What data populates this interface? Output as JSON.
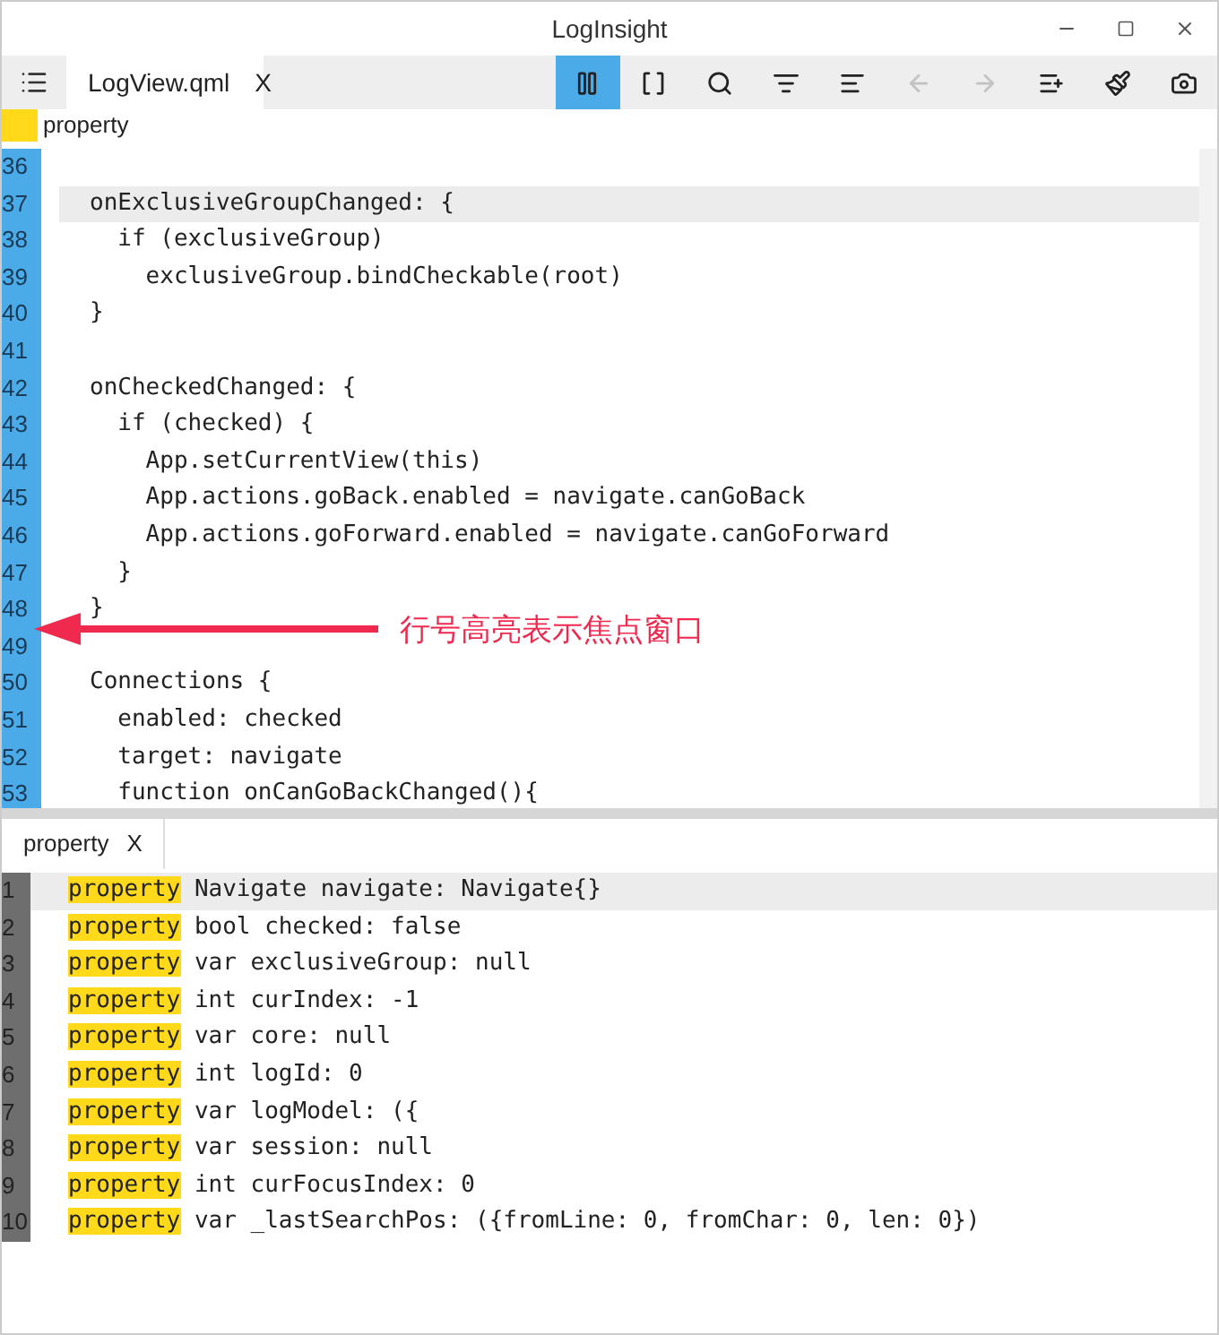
{
  "window": {
    "title": "LogInsight"
  },
  "tab": {
    "label": "LogView.qml",
    "close": "X",
    "selected": true
  },
  "toolbar": [
    {
      "kind": "pause",
      "selected": true,
      "disabled": false
    },
    {
      "kind": "brackets",
      "selected": false,
      "disabled": false
    },
    {
      "kind": "search",
      "selected": false,
      "disabled": false
    },
    {
      "kind": "filter",
      "selected": false,
      "disabled": false
    },
    {
      "kind": "align",
      "selected": false,
      "disabled": false
    },
    {
      "kind": "back",
      "selected": false,
      "disabled": true
    },
    {
      "kind": "forward",
      "selected": false,
      "disabled": true
    },
    {
      "kind": "listplus",
      "selected": false,
      "disabled": false
    },
    {
      "kind": "brush",
      "selected": false,
      "disabled": false
    },
    {
      "kind": "capture",
      "selected": false,
      "disabled": false
    }
  ],
  "filter_bar": {
    "color": "#ffd91a",
    "label": "property"
  },
  "top_editor": {
    "focused": true,
    "lines": [
      {
        "num": "36",
        "current": false
      },
      {
        "num": "37",
        "text": "onExclusiveGroupChanged: {",
        "current": true
      },
      {
        "num": "38",
        "text": "  if (exclusiveGroup)",
        "current": false
      },
      {
        "num": "39",
        "text": "    exclusiveGroup.bindCheckable(root)",
        "current": false
      },
      {
        "num": "40",
        "text": "}",
        "current": false
      },
      {
        "num": "41",
        "current": false
      },
      {
        "num": "42",
        "text": "onCheckedChanged: {",
        "current": false
      },
      {
        "num": "43",
        "text": "  if (checked) {",
        "current": false
      },
      {
        "num": "44",
        "text": "    App.setCurrentView(this)",
        "current": false
      },
      {
        "num": "45",
        "text": "    App.actions.goBack.enabled = navigate.canGoBack",
        "current": false
      },
      {
        "num": "46",
        "text": "    App.actions.goForward.enabled = navigate.canGoForward",
        "current": false
      },
      {
        "num": "47",
        "text": "  }",
        "current": false
      },
      {
        "num": "48",
        "text": "}",
        "current": false
      },
      {
        "num": "49",
        "current": false
      },
      {
        "num": "50",
        "text": "Connections {",
        "current": false
      },
      {
        "num": "51",
        "text": "  enabled: checked",
        "current": false
      },
      {
        "num": "52",
        "text": "  target: navigate",
        "current": false
      },
      {
        "num": "53",
        "text": "  function onCanGoBackChanged(){",
        "current": false
      }
    ]
  },
  "annotation": {
    "text": "行号高亮表示焦点窗口"
  },
  "bottom_tab": {
    "label": "property",
    "close": "X",
    "selected": true
  },
  "bottom_editor": {
    "focused": false,
    "lines": [
      {
        "num": "1",
        "match": "property",
        "text": "Navigate navigate: Navigate{}",
        "current": true
      },
      {
        "num": "2",
        "match": "property",
        "text": "bool checked: false",
        "current": false
      },
      {
        "num": "3",
        "match": "property",
        "text": "var exclusiveGroup: null",
        "current": false
      },
      {
        "num": "4",
        "match": "property",
        "text": "int curIndex: -1",
        "current": false
      },
      {
        "num": "5",
        "match": "property",
        "text": "var core: null",
        "current": false
      },
      {
        "num": "6",
        "match": "property",
        "text": "int logId: 0",
        "current": false
      },
      {
        "num": "7",
        "match": "property",
        "text": "var logModel: ({",
        "current": false
      },
      {
        "num": "8",
        "match": "property",
        "text": "var session: null",
        "current": false
      },
      {
        "num": "9",
        "match": "property",
        "text": "int curFocusIndex: 0",
        "current": false
      },
      {
        "num": "10",
        "match": "property",
        "text": "var _lastSearchPos: ({fromLine: 0, fromChar: 0, len: 0})",
        "current": false
      }
    ]
  }
}
